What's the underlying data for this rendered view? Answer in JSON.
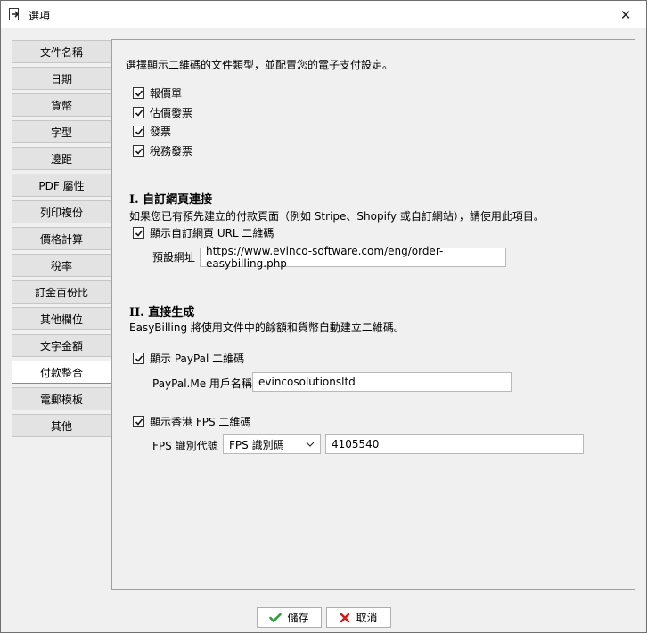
{
  "window": {
    "title": "選項",
    "close_icon": "close-icon"
  },
  "sidebar": {
    "items": [
      {
        "label": "文件名稱"
      },
      {
        "label": "日期"
      },
      {
        "label": "貨幣"
      },
      {
        "label": "字型"
      },
      {
        "label": "邊距"
      },
      {
        "label": "PDF 屬性"
      },
      {
        "label": "列印複份"
      },
      {
        "label": "價格計算"
      },
      {
        "label": "稅率"
      },
      {
        "label": "訂金百份比"
      },
      {
        "label": "其他欄位"
      },
      {
        "label": "文字金額"
      },
      {
        "label": "付款整合",
        "active": true
      },
      {
        "label": "電郵模板"
      },
      {
        "label": "其他"
      }
    ]
  },
  "main": {
    "intro": "選擇顯示二維碼的文件類型，並配置您的電子支付設定。",
    "doc_types": [
      {
        "label": "報價單",
        "checked": true
      },
      {
        "label": "估價發票",
        "checked": true
      },
      {
        "label": "發票",
        "checked": true
      },
      {
        "label": "稅務發票",
        "checked": true
      }
    ],
    "section1": {
      "title": "I. 自訂網頁連接",
      "desc": "如果您已有預先建立的付款頁面（例如 Stripe、Shopify 或自訂網站），請使用此項目。",
      "show_label": "顯示自訂網頁 URL 二維碼",
      "show_checked": true,
      "url_label": "預設網址",
      "url_value": "https://www.evinco-software.com/eng/order-easybilling.php"
    },
    "section2": {
      "title": "II. 直接生成",
      "desc": "EasyBilling 將使用文件中的餘額和貨幣自動建立二維碼。",
      "paypal_show_label": "顯示 PayPal 二維碼",
      "paypal_checked": true,
      "paypal_user_label": "PayPal.Me 用戶名稱",
      "paypal_user_value": "evincosolutionsltd",
      "fps_show_label": "顯示香港 FPS 二維碼",
      "fps_checked": true,
      "fps_id_label": "FPS 識別代號",
      "fps_type_value": "FPS 識別碼",
      "fps_id_value": "4105540"
    }
  },
  "footer": {
    "save_label": "儲存",
    "cancel_label": "取消"
  },
  "colors": {
    "check_green": "#2e9e3e",
    "cancel_red": "#d21a1a",
    "checkbox_blue": "#2266cc"
  }
}
